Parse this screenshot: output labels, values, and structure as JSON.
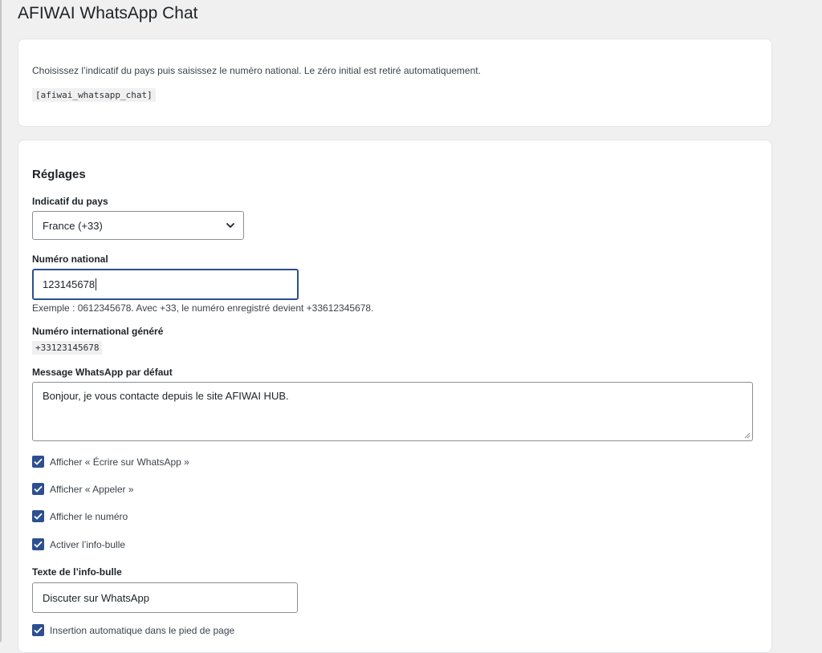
{
  "page": {
    "title": "AFIWAI WhatsApp Chat"
  },
  "intro": {
    "text": "Choisissez l’indicatif du pays puis saisissez le numéro national. Le zéro initial est retiré automatiquement.",
    "shortcode": "[afiwai_whatsapp_chat]"
  },
  "settings": {
    "title": "Réglages",
    "country": {
      "label": "Indicatif du pays",
      "selected": "France (+33)"
    },
    "national": {
      "label": "Numéro national",
      "value": "123145678",
      "help": "Exemple : 0612345678. Avec +33, le numéro enregistré devient +33612345678."
    },
    "international": {
      "label": "Numéro international généré",
      "value": "+33123145678"
    },
    "message": {
      "label": "Message WhatsApp par défaut",
      "value": "Bonjour, je vous contacte depuis le site AFIWAI HUB."
    },
    "checkboxes": [
      {
        "label": "Afficher « Écrire sur WhatsApp »",
        "checked": true
      },
      {
        "label": "Afficher « Appeler »",
        "checked": true
      },
      {
        "label": "Afficher le numéro",
        "checked": true
      },
      {
        "label": "Activer l’info-bulle",
        "checked": true
      }
    ],
    "tooltip": {
      "label": "Texte de l’info-bulle",
      "value": "Discuter sur WhatsApp"
    },
    "footer_insert": {
      "label": "Insertion automatique dans le pied de page",
      "checked": true
    }
  },
  "colors": {
    "accent": "#2c4f91",
    "background": "#f0f0f1",
    "card": "#ffffff"
  }
}
